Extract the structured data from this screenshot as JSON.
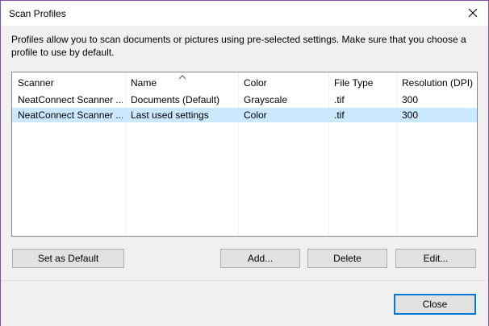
{
  "window": {
    "title": "Scan Profiles"
  },
  "description": "Profiles allow you to scan documents or pictures using pre-selected settings. Make sure that you choose a profile to use by default.",
  "table": {
    "columns": [
      "Scanner",
      "Name",
      "Color",
      "File Type",
      "Resolution (DPI)"
    ],
    "sorted_column": "Name",
    "rows": [
      {
        "scanner": "NeatConnect Scanner ...",
        "name": "Documents (Default)",
        "color": "Grayscale",
        "file_type": ".tif",
        "resolution": "300",
        "selected": false
      },
      {
        "scanner": "NeatConnect Scanner ...",
        "name": "Last used settings",
        "color": "Color",
        "file_type": ".tif",
        "resolution": "300",
        "selected": true
      }
    ]
  },
  "buttons": {
    "set_default": "Set as Default",
    "add": "Add...",
    "delete": "Delete",
    "edit": "Edit...",
    "close": "Close"
  },
  "colors": {
    "selection": "#cce8ff",
    "window_border": "#7a4fa0",
    "focus_border": "#0078d7"
  },
  "icons": {
    "close": "close-icon",
    "sort": "sort-ascending-icon"
  }
}
